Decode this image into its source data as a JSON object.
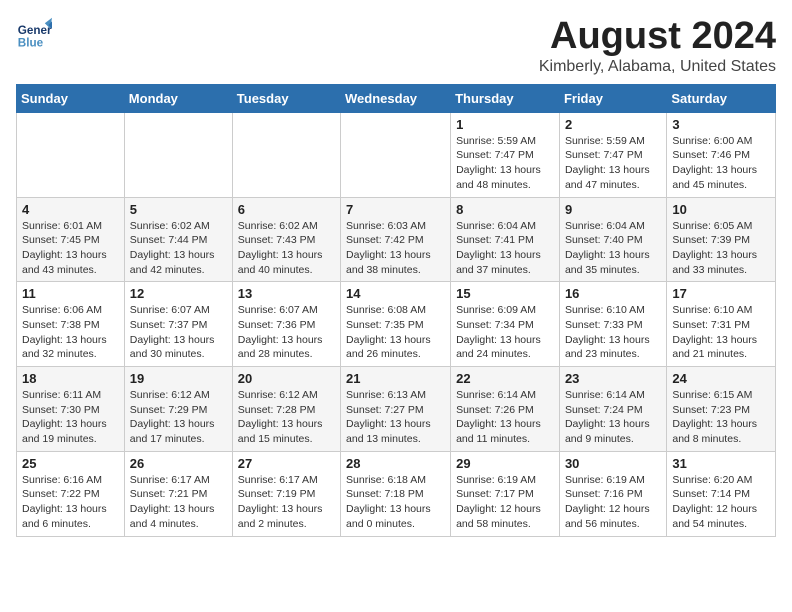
{
  "header": {
    "logo_general": "General",
    "logo_blue": "Blue",
    "title": "August 2024",
    "subtitle": "Kimberly, Alabama, United States"
  },
  "days_of_week": [
    "Sunday",
    "Monday",
    "Tuesday",
    "Wednesday",
    "Thursday",
    "Friday",
    "Saturday"
  ],
  "weeks": [
    [
      {
        "day": "",
        "info": ""
      },
      {
        "day": "",
        "info": ""
      },
      {
        "day": "",
        "info": ""
      },
      {
        "day": "",
        "info": ""
      },
      {
        "day": "1",
        "info": "Sunrise: 5:59 AM\nSunset: 7:47 PM\nDaylight: 13 hours\nand 48 minutes."
      },
      {
        "day": "2",
        "info": "Sunrise: 5:59 AM\nSunset: 7:47 PM\nDaylight: 13 hours\nand 47 minutes."
      },
      {
        "day": "3",
        "info": "Sunrise: 6:00 AM\nSunset: 7:46 PM\nDaylight: 13 hours\nand 45 minutes."
      }
    ],
    [
      {
        "day": "4",
        "info": "Sunrise: 6:01 AM\nSunset: 7:45 PM\nDaylight: 13 hours\nand 43 minutes."
      },
      {
        "day": "5",
        "info": "Sunrise: 6:02 AM\nSunset: 7:44 PM\nDaylight: 13 hours\nand 42 minutes."
      },
      {
        "day": "6",
        "info": "Sunrise: 6:02 AM\nSunset: 7:43 PM\nDaylight: 13 hours\nand 40 minutes."
      },
      {
        "day": "7",
        "info": "Sunrise: 6:03 AM\nSunset: 7:42 PM\nDaylight: 13 hours\nand 38 minutes."
      },
      {
        "day": "8",
        "info": "Sunrise: 6:04 AM\nSunset: 7:41 PM\nDaylight: 13 hours\nand 37 minutes."
      },
      {
        "day": "9",
        "info": "Sunrise: 6:04 AM\nSunset: 7:40 PM\nDaylight: 13 hours\nand 35 minutes."
      },
      {
        "day": "10",
        "info": "Sunrise: 6:05 AM\nSunset: 7:39 PM\nDaylight: 13 hours\nand 33 minutes."
      }
    ],
    [
      {
        "day": "11",
        "info": "Sunrise: 6:06 AM\nSunset: 7:38 PM\nDaylight: 13 hours\nand 32 minutes."
      },
      {
        "day": "12",
        "info": "Sunrise: 6:07 AM\nSunset: 7:37 PM\nDaylight: 13 hours\nand 30 minutes."
      },
      {
        "day": "13",
        "info": "Sunrise: 6:07 AM\nSunset: 7:36 PM\nDaylight: 13 hours\nand 28 minutes."
      },
      {
        "day": "14",
        "info": "Sunrise: 6:08 AM\nSunset: 7:35 PM\nDaylight: 13 hours\nand 26 minutes."
      },
      {
        "day": "15",
        "info": "Sunrise: 6:09 AM\nSunset: 7:34 PM\nDaylight: 13 hours\nand 24 minutes."
      },
      {
        "day": "16",
        "info": "Sunrise: 6:10 AM\nSunset: 7:33 PM\nDaylight: 13 hours\nand 23 minutes."
      },
      {
        "day": "17",
        "info": "Sunrise: 6:10 AM\nSunset: 7:31 PM\nDaylight: 13 hours\nand 21 minutes."
      }
    ],
    [
      {
        "day": "18",
        "info": "Sunrise: 6:11 AM\nSunset: 7:30 PM\nDaylight: 13 hours\nand 19 minutes."
      },
      {
        "day": "19",
        "info": "Sunrise: 6:12 AM\nSunset: 7:29 PM\nDaylight: 13 hours\nand 17 minutes."
      },
      {
        "day": "20",
        "info": "Sunrise: 6:12 AM\nSunset: 7:28 PM\nDaylight: 13 hours\nand 15 minutes."
      },
      {
        "day": "21",
        "info": "Sunrise: 6:13 AM\nSunset: 7:27 PM\nDaylight: 13 hours\nand 13 minutes."
      },
      {
        "day": "22",
        "info": "Sunrise: 6:14 AM\nSunset: 7:26 PM\nDaylight: 13 hours\nand 11 minutes."
      },
      {
        "day": "23",
        "info": "Sunrise: 6:14 AM\nSunset: 7:24 PM\nDaylight: 13 hours\nand 9 minutes."
      },
      {
        "day": "24",
        "info": "Sunrise: 6:15 AM\nSunset: 7:23 PM\nDaylight: 13 hours\nand 8 minutes."
      }
    ],
    [
      {
        "day": "25",
        "info": "Sunrise: 6:16 AM\nSunset: 7:22 PM\nDaylight: 13 hours\nand 6 minutes."
      },
      {
        "day": "26",
        "info": "Sunrise: 6:17 AM\nSunset: 7:21 PM\nDaylight: 13 hours\nand 4 minutes."
      },
      {
        "day": "27",
        "info": "Sunrise: 6:17 AM\nSunset: 7:19 PM\nDaylight: 13 hours\nand 2 minutes."
      },
      {
        "day": "28",
        "info": "Sunrise: 6:18 AM\nSunset: 7:18 PM\nDaylight: 13 hours\nand 0 minutes."
      },
      {
        "day": "29",
        "info": "Sunrise: 6:19 AM\nSunset: 7:17 PM\nDaylight: 12 hours\nand 58 minutes."
      },
      {
        "day": "30",
        "info": "Sunrise: 6:19 AM\nSunset: 7:16 PM\nDaylight: 12 hours\nand 56 minutes."
      },
      {
        "day": "31",
        "info": "Sunrise: 6:20 AM\nSunset: 7:14 PM\nDaylight: 12 hours\nand 54 minutes."
      }
    ]
  ]
}
